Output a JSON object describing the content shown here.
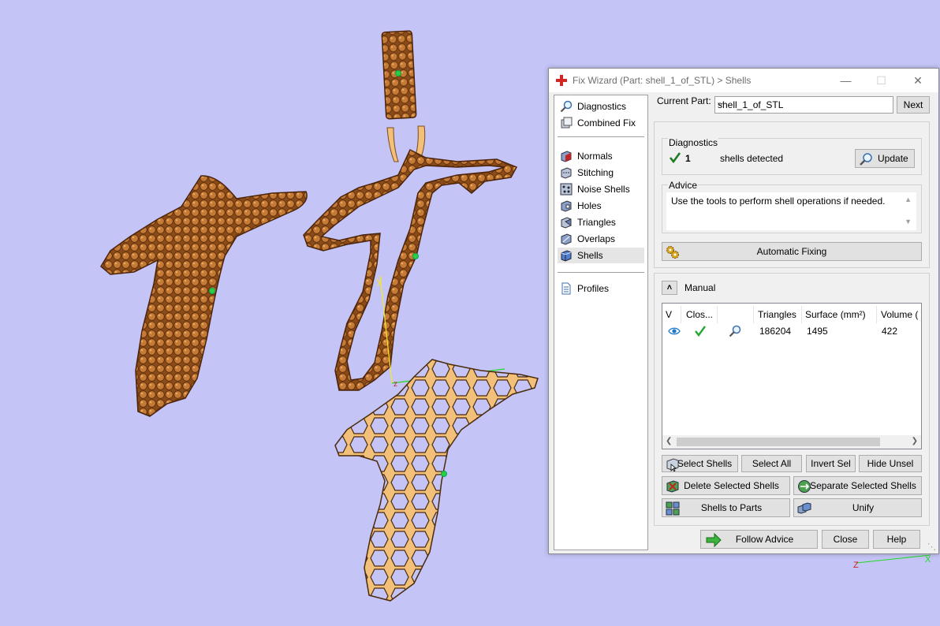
{
  "dialog": {
    "title": "Fix Wizard (Part: shell_1_of_STL) > Shells",
    "window_controls": {
      "minimize": "—",
      "maximize": "☐",
      "close": "✕"
    }
  },
  "nav": {
    "items": [
      {
        "label": "Diagnostics",
        "icon": "magnifier-icon"
      },
      {
        "label": "Combined Fix",
        "icon": "combined-fix-icon"
      },
      {
        "label": "Normals",
        "icon": "normals-cube-icon"
      },
      {
        "label": "Stitching",
        "icon": "stitching-cube-icon"
      },
      {
        "label": "Noise Shells",
        "icon": "noise-shells-icon"
      },
      {
        "label": "Holes",
        "icon": "holes-cube-icon"
      },
      {
        "label": "Triangles",
        "icon": "triangles-cube-icon"
      },
      {
        "label": "Overlaps",
        "icon": "overlaps-cube-icon"
      },
      {
        "label": "Shells",
        "icon": "shells-cube-icon",
        "selected": true
      },
      {
        "label": "Profiles",
        "icon": "document-icon"
      }
    ]
  },
  "header": {
    "current_part_label": "Current Part:",
    "current_part_value": "shell_1_of_STL",
    "next_label": "Next"
  },
  "diagnostics": {
    "group_label": "Diagnostics",
    "count": "1",
    "status_text": "shells detected",
    "update_label": "Update"
  },
  "advice": {
    "group_label": "Advice",
    "text": "Use the tools to perform shell operations if needed.",
    "automatic_fixing_label": "Automatic Fixing"
  },
  "manual": {
    "label": "Manual",
    "columns": [
      "V",
      "Clos...",
      "",
      "Triangles",
      "Surface (mm²)",
      "Volume ("
    ],
    "rows": [
      {
        "triangles": "186204",
        "surface": "1495",
        "volume": "422"
      }
    ],
    "buttons": {
      "select_shells": "Select Shells",
      "select_all": "Select All",
      "invert_sel": "Invert Sel",
      "hide_unsel": "Hide Unsel",
      "delete_selected": "Delete Selected Shells",
      "separate_selected": "Separate Selected Shells",
      "shells_to_parts": "Shells to Parts",
      "unify": "Unify"
    }
  },
  "footer": {
    "follow_advice": "Follow Advice",
    "close": "Close",
    "help": "Help"
  },
  "viewport": {
    "background": "#c4c4f7",
    "model_dark": "#b8773a",
    "model_light": "#f2c079",
    "axis_y_label": "y",
    "axis_z_label": "z",
    "corner_z_label": "Z",
    "corner_x_label": "X"
  }
}
